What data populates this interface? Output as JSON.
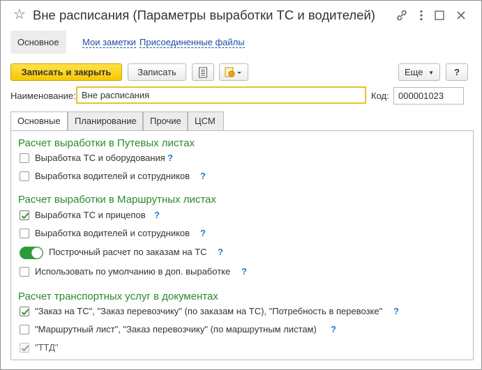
{
  "window": {
    "title": "Вне расписания (Параметры выработки ТС и водителей)"
  },
  "nav": {
    "tabs": [
      {
        "label": "Основное"
      },
      {
        "label": "Мои заметки"
      },
      {
        "label": "Присоединенные файлы"
      }
    ]
  },
  "toolbar": {
    "save_close_label": "Записать и закрыть",
    "save_label": "Записать",
    "more_label": "Еще",
    "help_label": "?"
  },
  "form": {
    "name_label": "Наименование:",
    "name_value": "Вне расписания",
    "code_label": "Код:",
    "code_value": "000001023"
  },
  "tabs": [
    {
      "label": "Основные"
    },
    {
      "label": "Планирование"
    },
    {
      "label": "Прочие"
    },
    {
      "label": "ЦСМ"
    }
  ],
  "sections": {
    "waybills": {
      "title": "Расчет выработки в Путевых листах",
      "items": [
        {
          "label": "Выработка ТС и оборудования",
          "checked": false
        },
        {
          "label": "Выработка водителей и сотрудников",
          "checked": false
        }
      ]
    },
    "route_sheets": {
      "title": "Расчет выработки в Маршрутных листах",
      "items": [
        {
          "label": "Выработка ТС и прицепов",
          "checked": true
        },
        {
          "label": "Выработка водителей и сотрудников",
          "checked": false
        },
        {
          "label": "Построчный расчет по заказам на ТС",
          "toggle_on": true
        },
        {
          "label": "Использовать по умолчанию в доп. выработке",
          "checked": false
        }
      ]
    },
    "transport_services": {
      "title": "Расчет транспортных услуг в документах",
      "items": [
        {
          "label": "\"Заказ на ТС\", \"Заказ перевозчику\" (по заказам на ТС), \"Потребность в перевозке\"",
          "checked": true
        },
        {
          "label": "\"Маршрутный лист\", \"Заказ перевозчику\" (по маршрутным листам)",
          "checked": false
        },
        {
          "label": "\"ТТД\"",
          "checked": true,
          "disabled": true
        }
      ]
    }
  },
  "help_mark": "?",
  "colors": {
    "accent_yellow": "#f7c800",
    "section_green": "#2a8a2a",
    "link_blue": "#1a4e9c",
    "help_blue": "#1a7bd6",
    "toggle_green": "#2d9a3a"
  }
}
